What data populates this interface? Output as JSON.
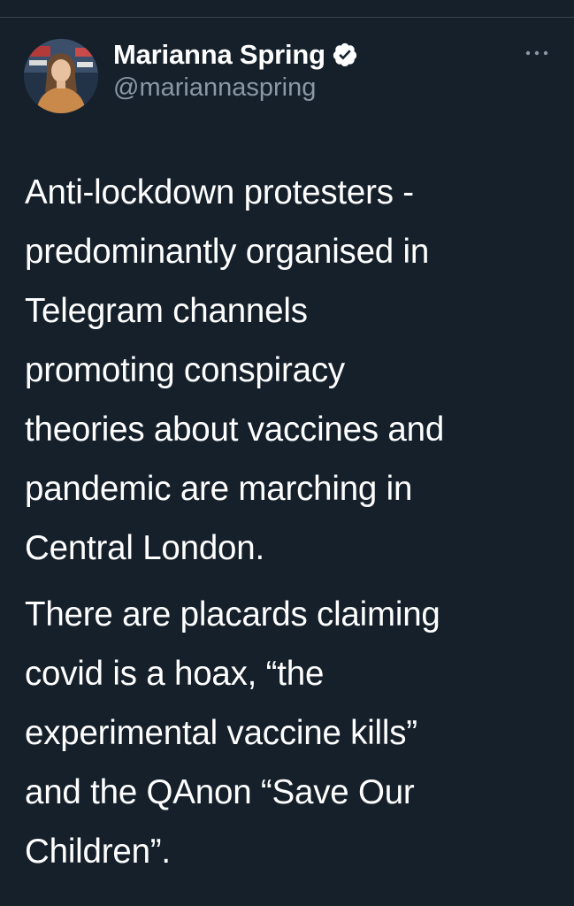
{
  "author": {
    "display_name": "Marianna Spring",
    "handle": "@mariannaspring",
    "verified": true,
    "avatar_icon": "profile-photo"
  },
  "more_icon": "more-horizontal-icon",
  "tweet": {
    "paragraphs": [
      [
        "Anti-lockdown protesters -",
        "predominantly organised in",
        "Telegram channels",
        "promoting conspiracy",
        "theories about vaccines and",
        "pandemic are marching in",
        "Central London."
      ],
      [
        "There are placards claiming",
        "covid is a hoax, “the",
        "experimental vaccine kills”",
        "and the QAnon “Save Our",
        "Children”."
      ]
    ]
  },
  "colors": {
    "background": "#15202b",
    "text": "#ffffff",
    "secondary_text": "#8b98a5",
    "divider": "#38444d"
  }
}
